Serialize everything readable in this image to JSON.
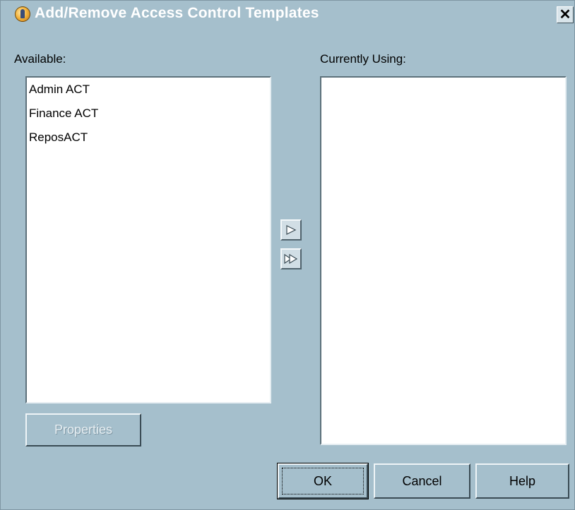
{
  "window": {
    "title": "Add/Remove Access Control Templates",
    "close_glyph": "✕",
    "icon": "sas-app-icon"
  },
  "available": {
    "label": "Available:",
    "items": [
      "Admin ACT",
      "Finance ACT",
      "ReposACT"
    ]
  },
  "current": {
    "label": "Currently Using:",
    "items": []
  },
  "move": {
    "move_one_icon": "single-right-arrow-icon",
    "move_all_icon": "double-right-arrow-icon"
  },
  "buttons": {
    "properties": "Properties",
    "ok": "OK",
    "cancel": "Cancel",
    "help": "Help"
  },
  "colors": {
    "dialog_bg": "#a5bfcc",
    "list_bg": "#ffffff",
    "title_text": "#ffffff"
  }
}
